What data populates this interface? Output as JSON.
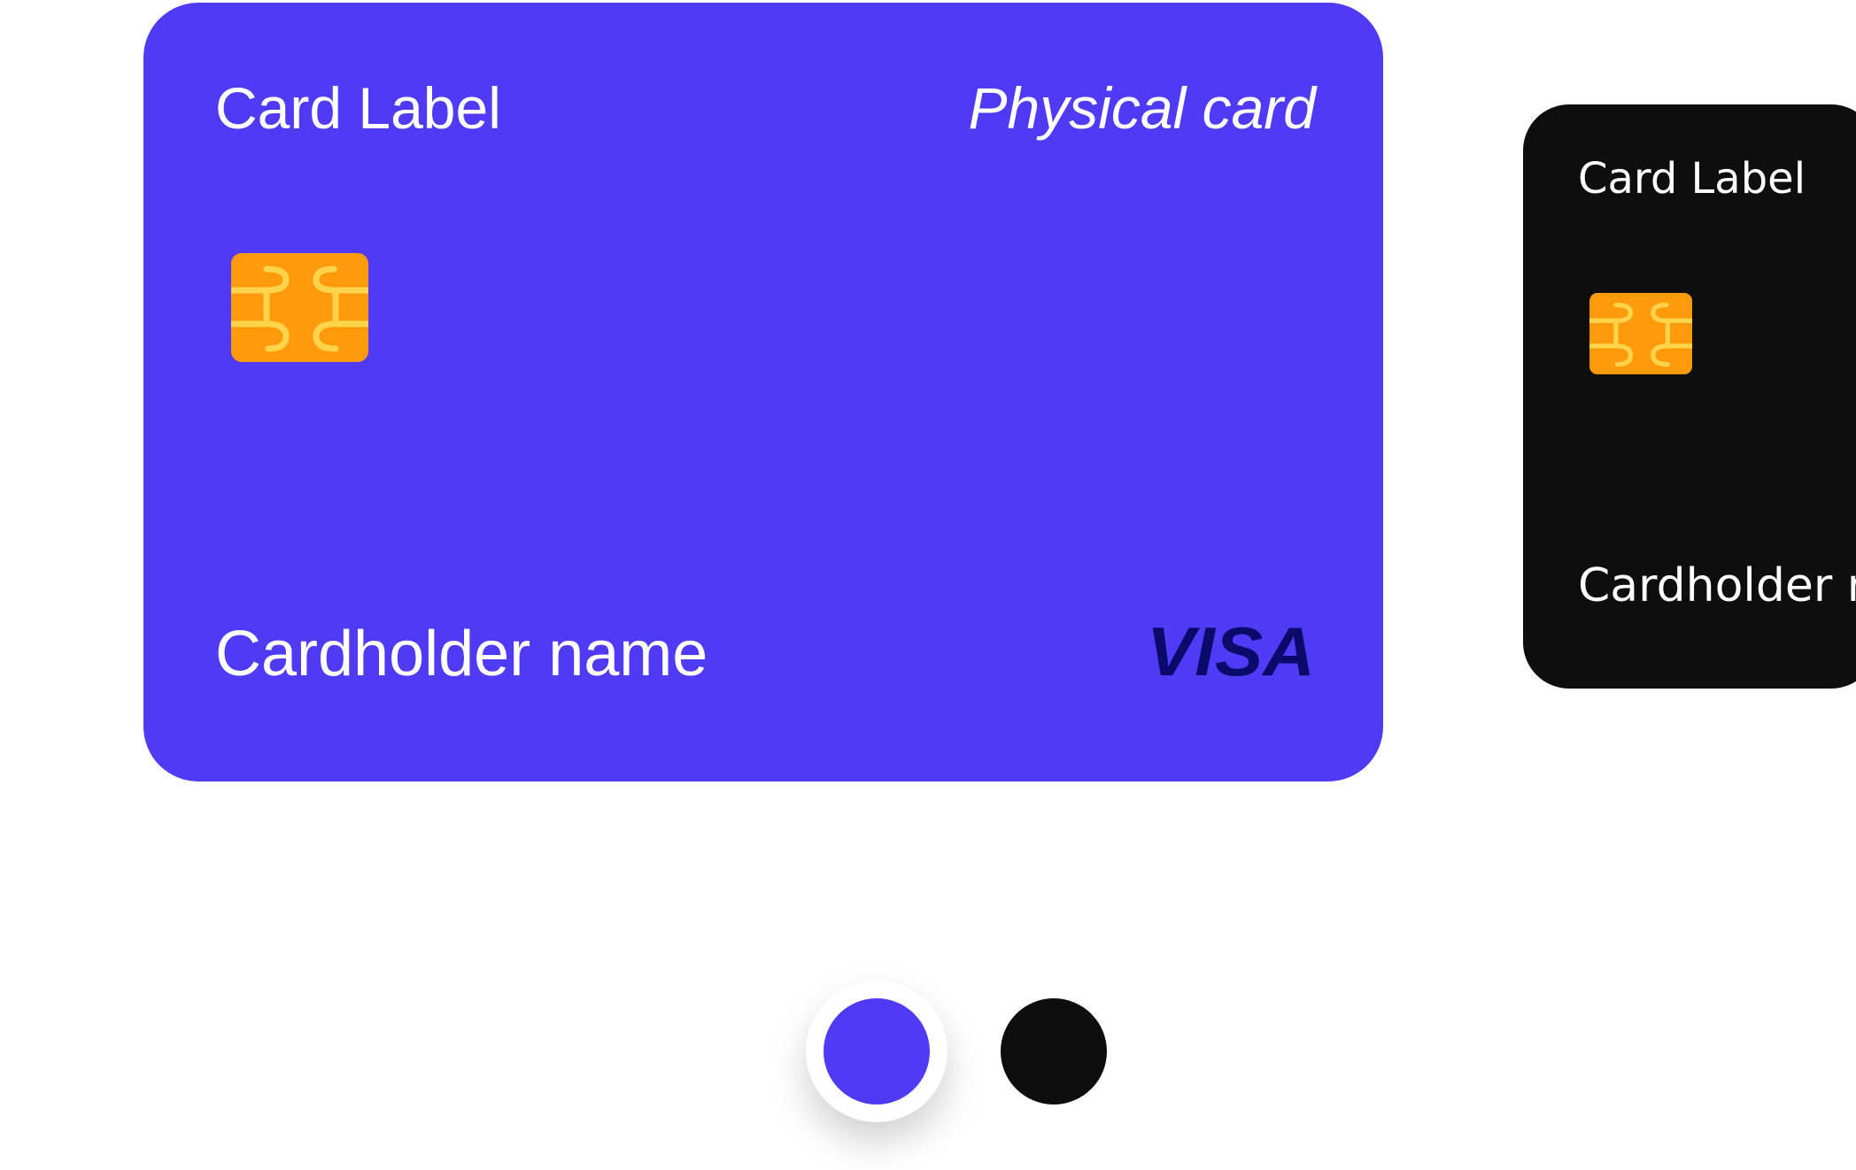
{
  "colors": {
    "card_primary": "#4f3bf6",
    "card_secondary": "#0e0e0e",
    "chip": "#ff9a0a",
    "chip_lines": "#ffd44a",
    "visa_logo": "#0a0a6a"
  },
  "primary_card": {
    "label": "Card Label",
    "type": "Physical card",
    "cardholder": "Cardholder name",
    "network": "VISA"
  },
  "secondary_card": {
    "label": "Card Label",
    "cardholder": "Cardholder name"
  },
  "color_picker": {
    "options": [
      {
        "name": "blue",
        "color": "#4f3bf6",
        "selected": true
      },
      {
        "name": "black",
        "color": "#0e0e0e",
        "selected": false
      }
    ]
  }
}
